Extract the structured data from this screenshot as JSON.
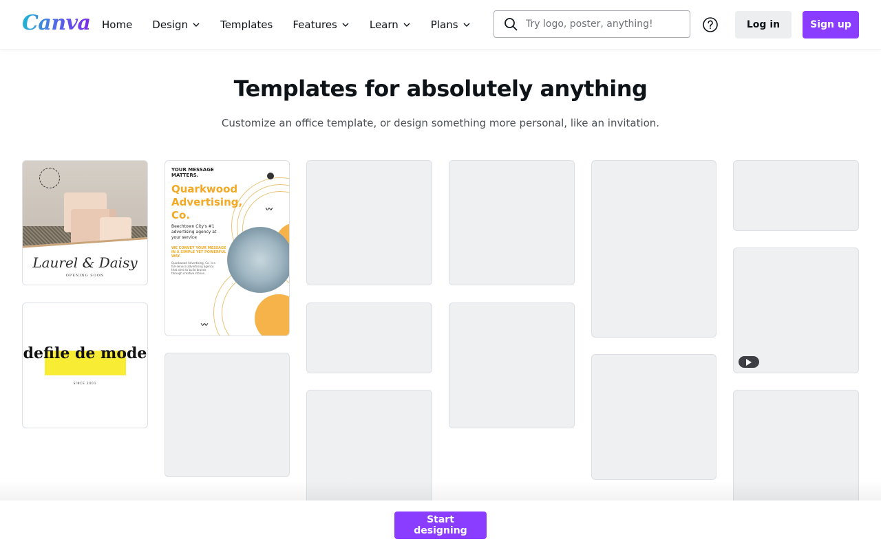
{
  "header": {
    "logo_text": "Canva",
    "nav": [
      {
        "label": "Home",
        "has_chevron": false
      },
      {
        "label": "Design",
        "has_chevron": true
      },
      {
        "label": "Templates",
        "has_chevron": false
      },
      {
        "label": "Features",
        "has_chevron": true
      },
      {
        "label": "Learn",
        "has_chevron": true
      },
      {
        "label": "Plans",
        "has_chevron": true
      }
    ],
    "search_placeholder": "Try logo, poster, anything!",
    "login_label": "Log in",
    "signup_label": "Sign up"
  },
  "hero": {
    "title": "Templates for absolutely anything",
    "subtitle": "Customize an office template, or design something more personal, like an invitation."
  },
  "templates": {
    "soap": {
      "script": "Laurel & Daisy",
      "small": "OPENING SOON"
    },
    "advertising": {
      "message": "YOUR MESSAGE MATTERS.",
      "name": "Quarkwood Advertising, Co.",
      "tagline": "Beechtown City's #1 advertising agency at your service",
      "convey": "WE CONVEY YOUR MESSAGE IN A SIMPLE YET POWERFUL WAY.",
      "description": "Quarkwood Advertising, Co. is a full-service advertising agency that aims to build brands through creative stories."
    },
    "defile": {
      "word": "defile de mode",
      "since": "SINCE 2001"
    }
  },
  "footer": {
    "start_label": "Start designing"
  },
  "colors": {
    "brand_purple": "#8b3dff",
    "placeholder_gray": "#eef0f1"
  },
  "icons": [
    "search-icon",
    "help-icon",
    "chevron-down-icon",
    "play-icon"
  ]
}
